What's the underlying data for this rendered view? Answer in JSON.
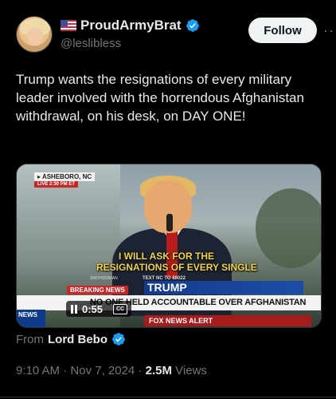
{
  "author": {
    "display_name": "ProudArmyBrat",
    "handle": "@leslibless",
    "flag_icon": "us-flag-icon",
    "verified_icon": "verified-badge-icon",
    "verified_color": "#1d9bf0"
  },
  "actions": {
    "follow_label": "Follow",
    "more_label": "···"
  },
  "tweet": {
    "text": "Trump wants the resignations of every military leader involved with the horrendous Afghanistan withdrawal, on his desk, on DAY ONE!"
  },
  "video": {
    "location_tag": "▸ ASHEBORO, NC",
    "live_tag": "LIVE  2:30 PM ET",
    "caption_line1": "I WILL ASK FOR THE",
    "caption_line2": "RESIGNATIONS OF EVERY SINGLE",
    "small_tag_left": "SMITHSONIAN",
    "small_tag_right": "TEXT NC TO 88022",
    "breaking_label": "BREAKING NEWS",
    "headline_name": "TRUMP",
    "lower_third": "NO ONE HELD ACCOUNTABLE OVER AFGHANISTAN",
    "news_badge": "NEWS",
    "alert_bar": "FOX NEWS ALERT",
    "elapsed_time": "0:55",
    "cc_label": "CC"
  },
  "source": {
    "prefix": "From",
    "name": "Lord Bebo"
  },
  "meta": {
    "time": "9:10 AM",
    "sep1": "·",
    "date": "Nov 7, 2024",
    "sep2": "·",
    "views_count": "2.5M",
    "views_label": "Views"
  }
}
